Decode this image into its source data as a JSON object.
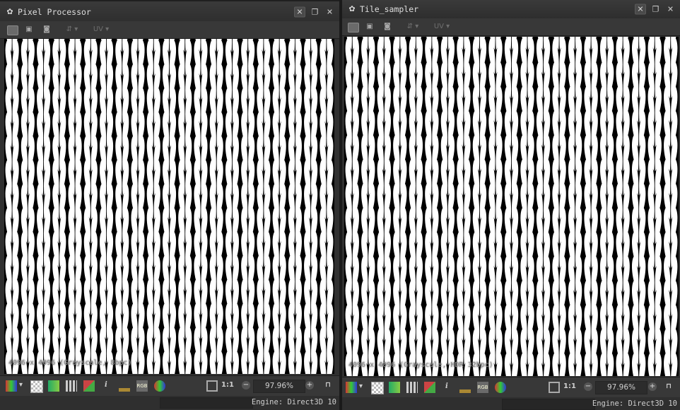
{
  "panels": [
    {
      "title": "Pixel Processor",
      "image_info": "4096 x 4096 (Grayscale, 8bpc)",
      "zoom": "97.96%",
      "zoom_one_to_one": "1:1",
      "engine": "Engine: Direct3D 10",
      "toolbar_uv_label": "UV",
      "bottom_rgb_label": "RGB",
      "pattern": {
        "columns": 21,
        "rows": 14,
        "foreground": "#ffffff",
        "background": "#000000"
      }
    },
    {
      "title": "Tile_sampler",
      "image_info": "4096 x 4096 (Grayscale, HDR 32bpc)",
      "zoom": "97.96%",
      "zoom_one_to_one": "1:1",
      "engine": "Engine: Direct3D 10",
      "toolbar_uv_label": "UV",
      "bottom_rgb_label": "RGB",
      "pattern": {
        "columns": 21,
        "rows": 14,
        "foreground": "#ffffff",
        "background": "#000000"
      }
    }
  ],
  "icons": {
    "title": "substance-node-icon",
    "toolbar": [
      "channels-icon",
      "save-icon",
      "camera-icon",
      "share-icon",
      "uv-icon"
    ],
    "bottom": [
      "color-picker-icon",
      "checker-icon",
      "gradient-icon",
      "grid-icon",
      "tile-icon",
      "info-icon",
      "histogram-icon",
      "rgb-icon",
      "color-wheel-icon",
      "fit-icon",
      "zoom-out-icon",
      "zoom-in-icon",
      "lock-icon"
    ]
  },
  "colors": {
    "accent_checker": "#8a8a8a",
    "panel_bg": "#303030"
  }
}
